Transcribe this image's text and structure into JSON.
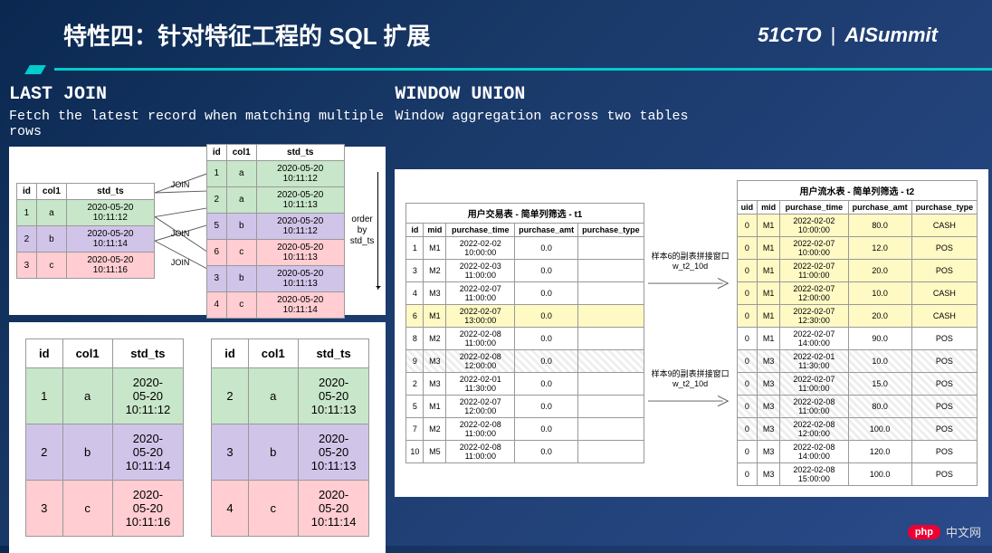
{
  "header": {
    "title": "特性四：针对特征工程的 SQL 扩展",
    "logo_left": "51CTO",
    "logo_sep": "|",
    "logo_right": "AISummit"
  },
  "left": {
    "title": "LAST JOIN",
    "subtitle": "Fetch the latest record when matching multiple rows",
    "join_label": "JOIN",
    "orderby_label": "order by std_ts",
    "table_left": {
      "headers": [
        "id",
        "col1",
        "std_ts"
      ],
      "rows": [
        {
          "cls": "row-g",
          "cells": [
            "1",
            "a",
            "2020-05-20 10:11:12"
          ]
        },
        {
          "cls": "row-p",
          "cells": [
            "2",
            "b",
            "2020-05-20 10:11:14"
          ]
        },
        {
          "cls": "row-r",
          "cells": [
            "3",
            "c",
            "2020-05-20 10:11:16"
          ]
        }
      ]
    },
    "table_right": {
      "headers": [
        "id",
        "col1",
        "std_ts"
      ],
      "rows": [
        {
          "cls": "row-g",
          "cells": [
            "1",
            "a",
            "2020-05-20 10:11:12"
          ]
        },
        {
          "cls": "row-g",
          "cells": [
            "2",
            "a",
            "2020-05-20 10:11:13"
          ]
        },
        {
          "cls": "row-p",
          "cells": [
            "5",
            "b",
            "2020-05-20 10:11:12"
          ]
        },
        {
          "cls": "row-r",
          "cells": [
            "6",
            "c",
            "2020-05-20 10:11:13"
          ]
        },
        {
          "cls": "row-p",
          "cells": [
            "3",
            "b",
            "2020-05-20 10:11:13"
          ]
        },
        {
          "cls": "row-r",
          "cells": [
            "4",
            "c",
            "2020-05-20 10:11:14"
          ]
        }
      ]
    },
    "result_left": {
      "headers": [
        "id",
        "col1",
        "std_ts"
      ],
      "rows": [
        {
          "cls": "row-g",
          "cells": [
            "1",
            "a",
            "2020-05-20 10:11:12"
          ]
        },
        {
          "cls": "row-p",
          "cells": [
            "2",
            "b",
            "2020-05-20 10:11:14"
          ]
        },
        {
          "cls": "row-r",
          "cells": [
            "3",
            "c",
            "2020-05-20 10:11:16"
          ]
        }
      ]
    },
    "result_right": {
      "headers": [
        "id",
        "col1",
        "std_ts"
      ],
      "rows": [
        {
          "cls": "row-g",
          "cells": [
            "2",
            "a",
            "2020-05-20 10:11:13"
          ]
        },
        {
          "cls": "row-p",
          "cells": [
            "3",
            "b",
            "2020-05-20 10:11:13"
          ]
        },
        {
          "cls": "row-r",
          "cells": [
            "4",
            "c",
            "2020-05-20 10:11:14"
          ]
        }
      ]
    }
  },
  "right": {
    "title": "WINDOW UNION",
    "subtitle": "Window aggregation across two tables",
    "mid_label_top": "样本6的副表拼接窗口w_t2_10d",
    "mid_label_bot": "样本9的副表拼接窗口w_t2_10d",
    "table_src": {
      "caption": "用户交易表 - 简单列筛选 - t1",
      "headers": [
        "id",
        "mid",
        "purchase_time",
        "purchase_amt",
        "purchase_type"
      ],
      "rows": [
        {
          "cls": "",
          "cells": [
            "1",
            "M1",
            "2022-02-02 10:00:00",
            "0.0",
            ""
          ]
        },
        {
          "cls": "",
          "cells": [
            "3",
            "M2",
            "2022-02-03 11:00:00",
            "0.0",
            ""
          ]
        },
        {
          "cls": "",
          "cells": [
            "4",
            "M3",
            "2022-02-07 11:00:00",
            "0.0",
            ""
          ]
        },
        {
          "cls": "row-y",
          "cells": [
            "6",
            "M1",
            "2022-02-07 13:00:00",
            "0.0",
            ""
          ]
        },
        {
          "cls": "",
          "cells": [
            "8",
            "M2",
            "2022-02-08 11:00:00",
            "0.0",
            ""
          ]
        },
        {
          "cls": "row-h",
          "cells": [
            "9",
            "M3",
            "2022-02-08 12:00:00",
            "0.0",
            ""
          ]
        },
        {
          "cls": "",
          "cells": [
            "2",
            "M3",
            "2022-02-01 11:30:00",
            "0.0",
            ""
          ]
        },
        {
          "cls": "",
          "cells": [
            "5",
            "M1",
            "2022-02-07 12:00:00",
            "0.0",
            ""
          ]
        },
        {
          "cls": "",
          "cells": [
            "7",
            "M2",
            "2022-02-08 11:00:00",
            "0.0",
            ""
          ]
        },
        {
          "cls": "",
          "cells": [
            "10",
            "M5",
            "2022-02-08 11:00:00",
            "0.0",
            ""
          ]
        }
      ]
    },
    "table_dst": {
      "caption": "用户流水表 - 简单列筛选 - t2",
      "headers": [
        "uid",
        "mid",
        "purchase_time",
        "purchase_amt",
        "purchase_type"
      ],
      "rows": [
        {
          "cls": "row-y",
          "cells": [
            "0",
            "M1",
            "2022-02-02 10:00:00",
            "80.0",
            "CASH"
          ]
        },
        {
          "cls": "row-y",
          "cells": [
            "0",
            "M1",
            "2022-02-07 10:00:00",
            "12.0",
            "POS"
          ]
        },
        {
          "cls": "row-y",
          "cells": [
            "0",
            "M1",
            "2022-02-07 11:00:00",
            "20.0",
            "POS"
          ]
        },
        {
          "cls": "row-y",
          "cells": [
            "0",
            "M1",
            "2022-02-07 12:00:00",
            "10.0",
            "CASH"
          ]
        },
        {
          "cls": "row-y",
          "cells": [
            "0",
            "M1",
            "2022-02-07 12:30:00",
            "20.0",
            "CASH"
          ]
        },
        {
          "cls": "",
          "cells": [
            "0",
            "M1",
            "2022-02-07 14:00:00",
            "90.0",
            "POS"
          ]
        },
        {
          "cls": "row-h",
          "cells": [
            "0",
            "M3",
            "2022-02-01 11:30:00",
            "10.0",
            "POS"
          ]
        },
        {
          "cls": "row-h",
          "cells": [
            "0",
            "M3",
            "2022-02-07 11:00:00",
            "15.0",
            "POS"
          ]
        },
        {
          "cls": "row-h",
          "cells": [
            "0",
            "M3",
            "2022-02-08 11:00:00",
            "80.0",
            "POS"
          ]
        },
        {
          "cls": "row-h",
          "cells": [
            "0",
            "M3",
            "2022-02-08 12:00:00",
            "100.0",
            "POS"
          ]
        },
        {
          "cls": "",
          "cells": [
            "0",
            "M3",
            "2022-02-08 14:00:00",
            "120.0",
            "POS"
          ]
        },
        {
          "cls": "",
          "cells": [
            "0",
            "M3",
            "2022-02-08 15:00:00",
            "100.0",
            "POS"
          ]
        }
      ]
    }
  },
  "watermark": {
    "badge": "php",
    "text": "中文网"
  }
}
